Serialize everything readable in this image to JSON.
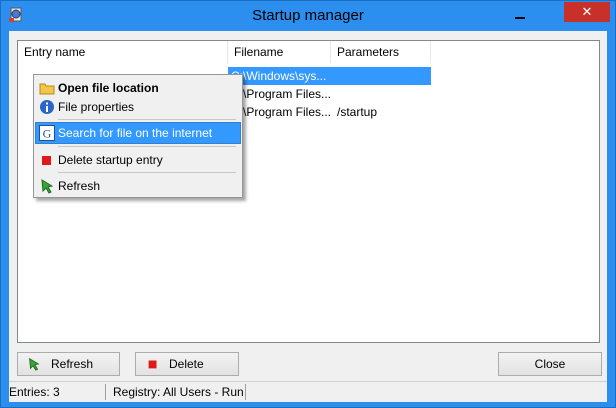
{
  "window": {
    "title": "Startup manager",
    "close_glyph": "✕"
  },
  "list": {
    "columns": [
      "Entry name",
      "Filename",
      "Parameters"
    ],
    "rows": [
      {
        "filename": "C:\\Windows\\sys...",
        "parameters": ""
      },
      {
        "filename": "C:\\Program Files...",
        "parameters": ""
      },
      {
        "filename": "C:\\Program Files...",
        "parameters": "/startup"
      }
    ]
  },
  "context_menu": {
    "items": [
      {
        "label": "Open file location",
        "icon": "folder-icon"
      },
      {
        "label": "File properties",
        "icon": "info-icon"
      },
      {
        "label": "Search for file on the internet",
        "icon": "google-icon"
      },
      {
        "label": "Delete startup entry",
        "icon": "delete-icon"
      },
      {
        "label": "Refresh",
        "icon": "refresh-icon"
      }
    ]
  },
  "buttons": {
    "refresh": "Refresh",
    "delete": "Delete",
    "close": "Close"
  },
  "status": {
    "entries": "Entries: 3",
    "registry": "Registry: All Users - Run"
  },
  "colors": {
    "titlebar": "#2c8ff0",
    "selection": "#3399ff",
    "close_button": "#c7312a"
  }
}
